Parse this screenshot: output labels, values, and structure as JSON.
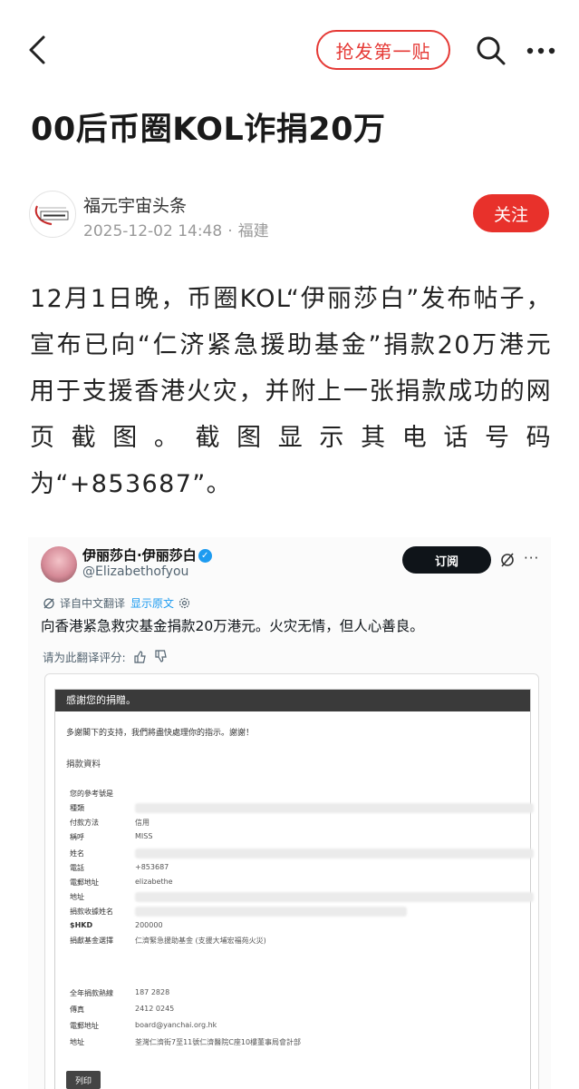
{
  "nav": {
    "grab_first_label": "抢发第一贴",
    "icons": {
      "back": "back-chevron-icon",
      "search": "search-icon",
      "more": "more-dots-icon"
    }
  },
  "article": {
    "title": "00后币圈KOL诈捐20万",
    "author": {
      "name": "福元宇宙头条",
      "date": "2025-12-02 14:48",
      "location": "福建",
      "follow_label": "关注"
    },
    "body": "12月1日晚，币圈KOL“伊丽莎白”发布帖子，宣布已向“仁济紧急援助基金”捐款20万港元用于支援香港火灾，并附上一张捐款成功的网页截图。截图显示其电话号码为“+853687”。"
  },
  "embedded": {
    "display_name": "伊丽莎白·伊丽莎白",
    "handle": "@Elizabethofyou",
    "subscribe_label": "订阅",
    "translated_from": "译自中文翻译",
    "show_original": "显示原文",
    "tweet_text": "向香港紧急救灾基金捐款20万港元。火灾无情，但人心善良。",
    "rate_prompt": "请为此翻译评分:",
    "receipt": {
      "header": "感謝您的捐贈。",
      "message": "多謝閣下的支持，我們將盡快處理你的指示。謝謝！",
      "section": "捐款資料",
      "rows": [
        {
          "label": "您的參考號是",
          "value": ""
        },
        {
          "label": "種類",
          "value": ""
        },
        {
          "label": "付款方法",
          "value": "信用"
        },
        {
          "label": "稱呼",
          "value": "MISS"
        },
        {
          "label": "姓名",
          "value": ""
        },
        {
          "label": "電話",
          "value": "+853687"
        },
        {
          "label": "電郵地址",
          "value": "elizabethe"
        },
        {
          "label": "地址",
          "value": ""
        },
        {
          "label": "捐款收據姓名",
          "value": ""
        },
        {
          "label": "$HKD",
          "value": "200000"
        },
        {
          "label": "捐獻基金選擇",
          "value": "仁濟緊急援助基金 (支援大埔宏福苑火災)"
        }
      ],
      "contact_rows": [
        {
          "label": "全年捐款熱線",
          "value": "187 2828"
        },
        {
          "label": "傳真",
          "value": "2412 0245"
        },
        {
          "label": "電郵地址",
          "value": "board@yanchai.org.hk"
        },
        {
          "label": "地址",
          "value": "荃灣仁濟街7至11號仁濟醫院C座10樓董事局會計部"
        }
      ],
      "print_label": "列印"
    }
  },
  "colors": {
    "accent": "#e8312b",
    "link": "#1d9bf0"
  }
}
